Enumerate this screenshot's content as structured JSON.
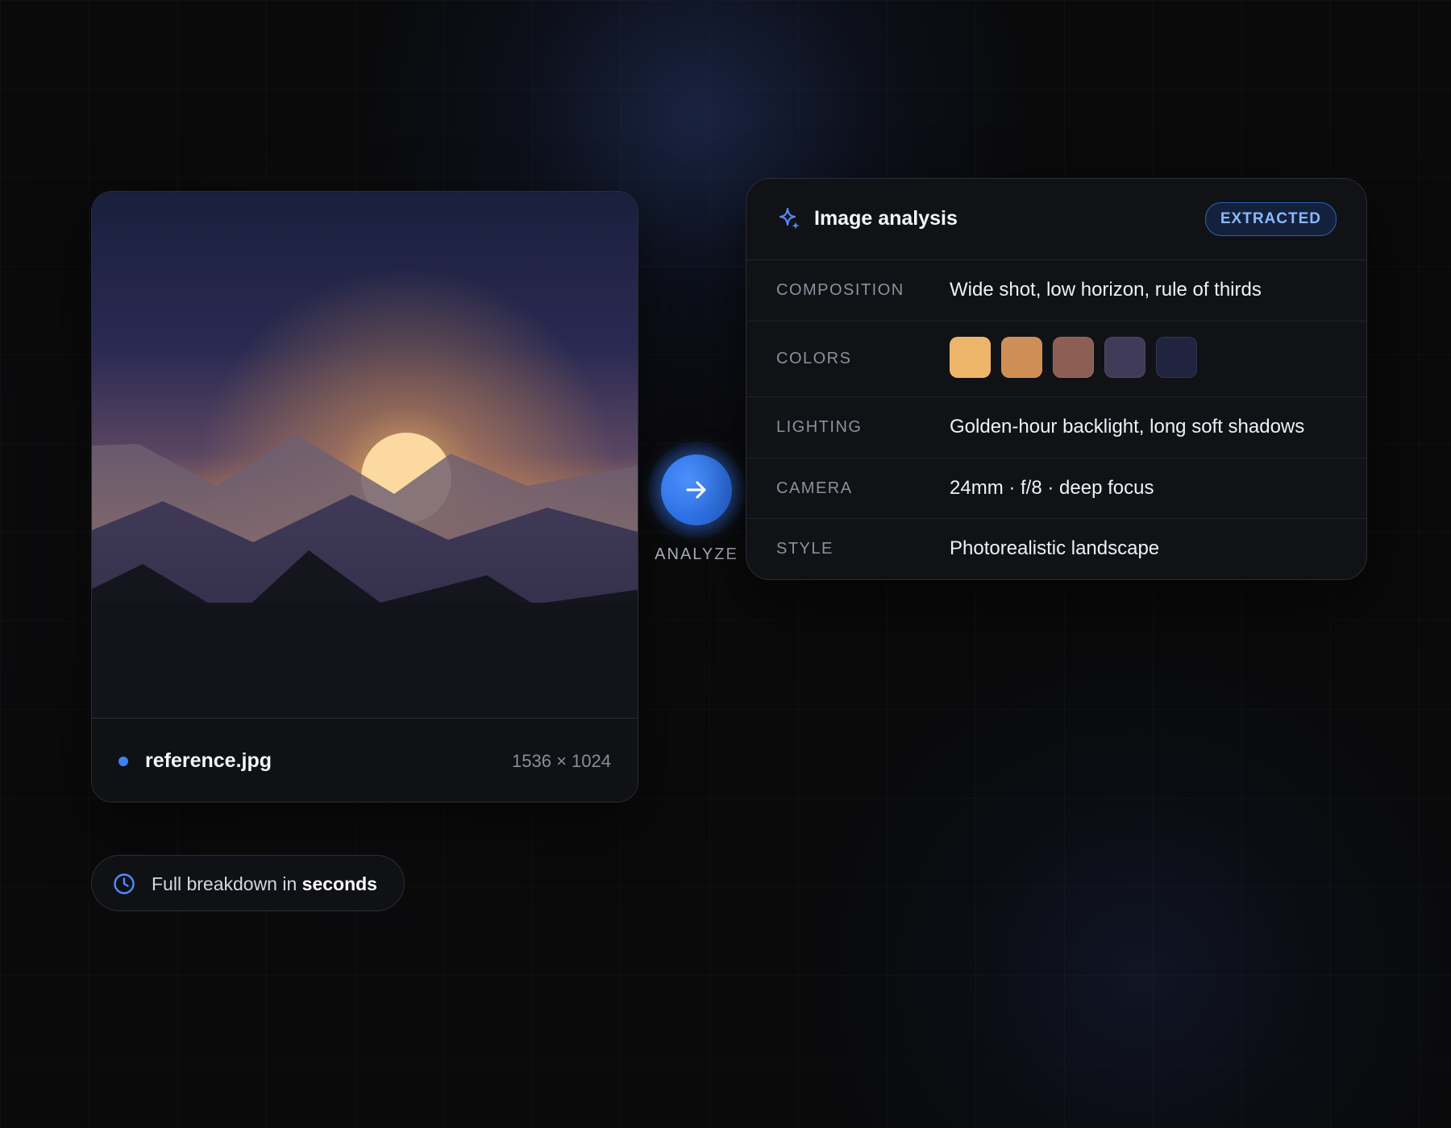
{
  "image_card": {
    "file_name": "reference.jpg",
    "dimensions": "1536 × 1024",
    "status_color": "#3b82f6"
  },
  "analyze": {
    "label": "ANALYZE",
    "icon": "arrow-right-icon",
    "accent": "#3b82f6"
  },
  "analysis": {
    "title": "Image analysis",
    "badge": "EXTRACTED",
    "icon": "sparkle-icon",
    "rows": [
      {
        "label": "COMPOSITION",
        "value": "Wide shot, low horizon, rule of thirds"
      },
      {
        "label": "COLORS",
        "swatches": [
          "#EDB56A",
          "#CE8E55",
          "#8C5E54",
          "#3E3A57",
          "#20243F"
        ]
      },
      {
        "label": "LIGHTING",
        "value": "Golden-hour backlight, long soft shadows"
      },
      {
        "label": "CAMERA",
        "value": "24mm · f/8 · deep focus"
      },
      {
        "label": "STYLE",
        "value": "Photorealistic landscape"
      }
    ]
  },
  "speed": {
    "icon": "clock-icon",
    "text_prefix": "Full breakdown in ",
    "text_bold": "seconds"
  }
}
